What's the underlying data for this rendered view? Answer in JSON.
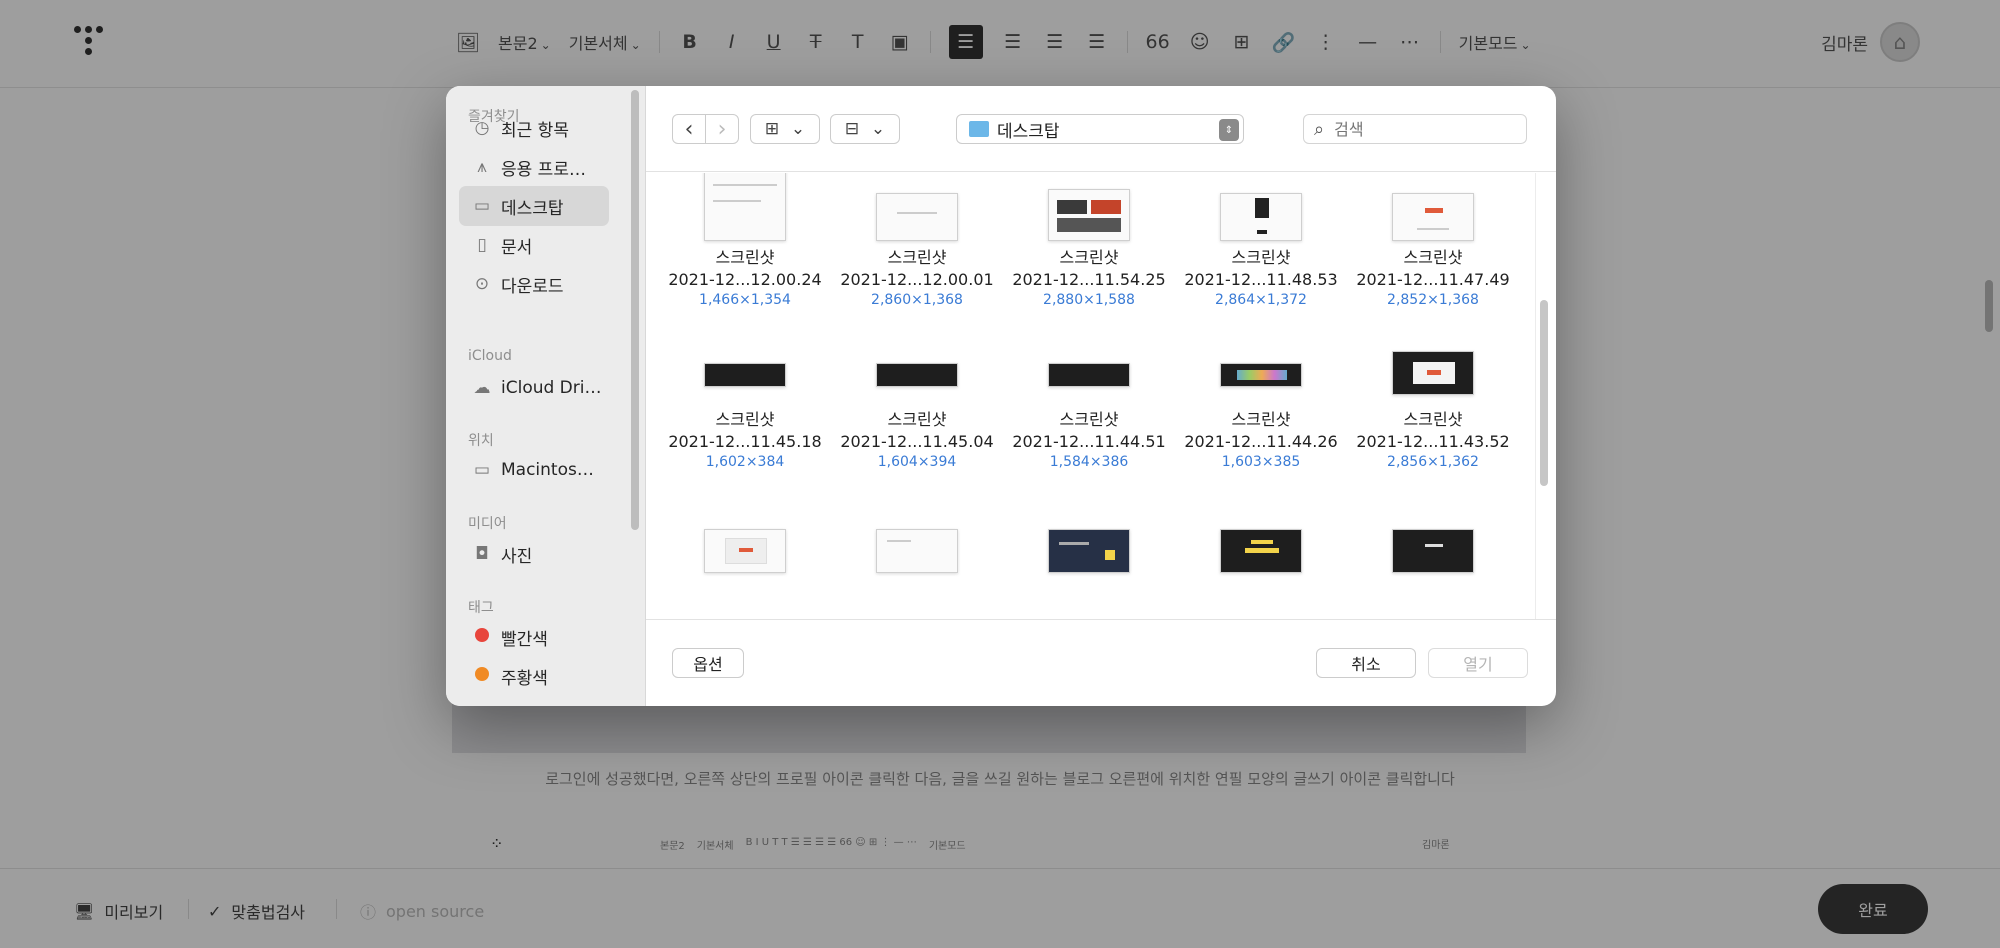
{
  "editor": {
    "toolbar": {
      "paragraph_style": "본문2",
      "font": "기본서체",
      "mode": "기본모드",
      "user_name": "김마론"
    },
    "caption": "로그인에 성공했다면, 오른쪽 상단의 프로필 아이콘 클릭한 다음, 글을 쓰길 원하는 블로그 오른편에 위치한 연필 모양의 글쓰기 아이콘 클릭합니다",
    "mini_toolbar": {
      "paragraph_style": "본문2",
      "font": "기본서체",
      "mode": "기본모드",
      "user_name": "김마론"
    },
    "bottom": {
      "preview": "미리보기",
      "spellcheck": "맞춤법검사",
      "open_source": "open source",
      "done": "완료"
    }
  },
  "dialog": {
    "sidebar": {
      "favorites_header": "즐겨찾기",
      "favorites": [
        {
          "label": "최근 항목",
          "icon": "clock-icon"
        },
        {
          "label": "응용 프로…",
          "icon": "apps-icon"
        },
        {
          "label": "데스크탑",
          "icon": "desktop-icon"
        },
        {
          "label": "문서",
          "icon": "document-icon"
        },
        {
          "label": "다운로드",
          "icon": "download-icon"
        }
      ],
      "icloud_header": "iCloud",
      "icloud": [
        {
          "label": "iCloud Dri…",
          "icon": "cloud-icon"
        }
      ],
      "location_header": "위치",
      "locations": [
        {
          "label": "Macintos…",
          "icon": "laptop-icon"
        }
      ],
      "media_header": "미디어",
      "media": [
        {
          "label": "사진",
          "icon": "camera-icon"
        }
      ],
      "tags_header": "태그",
      "tags": [
        {
          "label": "빨간색",
          "color": "#e8453c"
        },
        {
          "label": "주황색",
          "color": "#f08a24"
        }
      ]
    },
    "toolbar": {
      "location": "데스크탑",
      "search_placeholder": "검색"
    },
    "files": [
      {
        "name": "스크린샷",
        "date": "2021-12...12.00.24",
        "dims": "1,466×1,354"
      },
      {
        "name": "스크린샷",
        "date": "2021-12...12.00.01",
        "dims": "2,860×1,368"
      },
      {
        "name": "스크린샷",
        "date": "2021-12...11.54.25",
        "dims": "2,880×1,588"
      },
      {
        "name": "스크린샷",
        "date": "2021-12...11.48.53",
        "dims": "2,864×1,372"
      },
      {
        "name": "스크린샷",
        "date": "2021-12...11.47.49",
        "dims": "2,852×1,368"
      },
      {
        "name": "스크린샷",
        "date": "2021-12...11.45.18",
        "dims": "1,602×384"
      },
      {
        "name": "스크린샷",
        "date": "2021-12...11.45.04",
        "dims": "1,604×394"
      },
      {
        "name": "스크린샷",
        "date": "2021-12...11.44.51",
        "dims": "1,584×386"
      },
      {
        "name": "스크린샷",
        "date": "2021-12...11.44.26",
        "dims": "1,603×385"
      },
      {
        "name": "스크린샷",
        "date": "2021-12...11.43.52",
        "dims": "2,856×1,362"
      }
    ],
    "footer": {
      "options": "옵션",
      "cancel": "취소",
      "open": "열기"
    }
  },
  "colors": {
    "accent_blue": "#3a7bd5",
    "selected_sidebar": "#d7d7d7",
    "done_button": "#3a3a3a"
  }
}
